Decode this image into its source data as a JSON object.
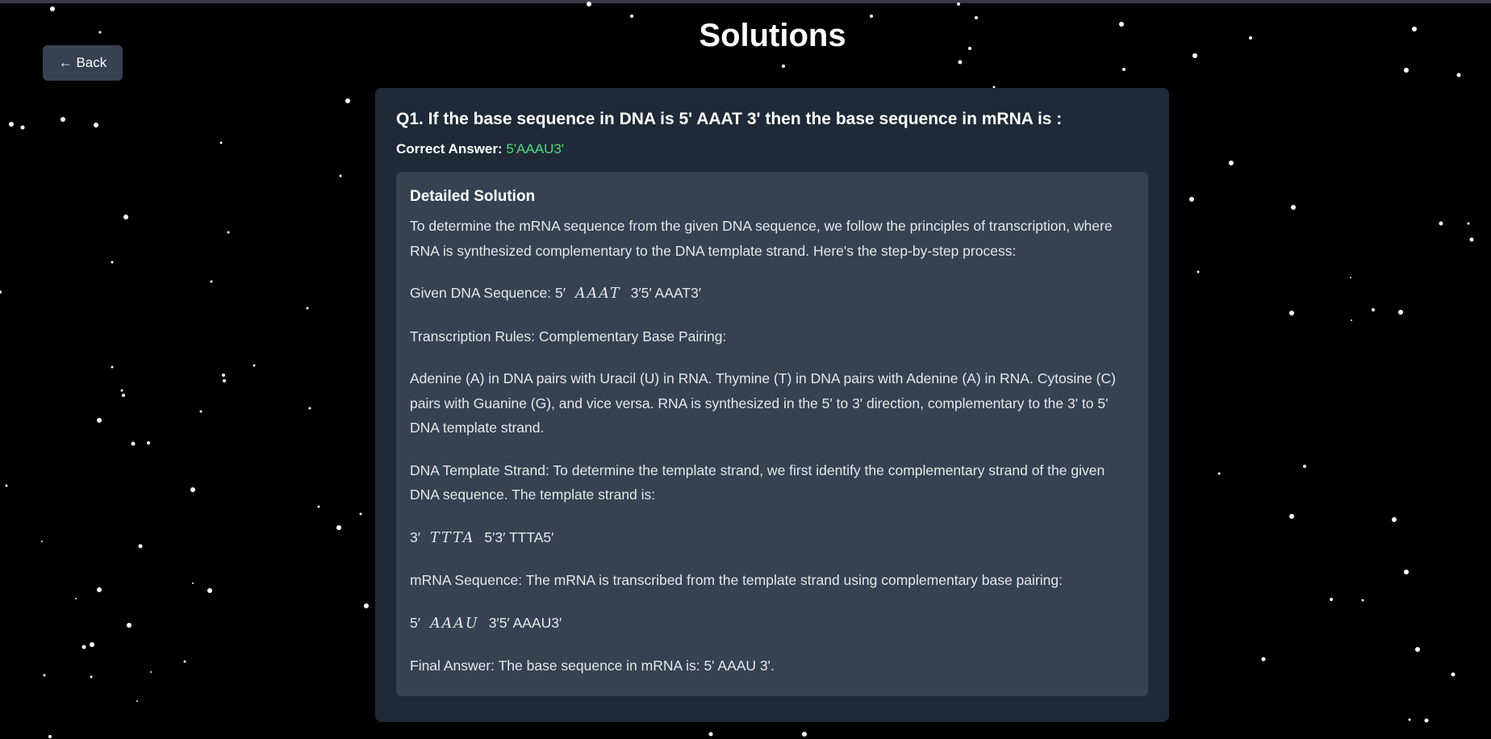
{
  "header": {
    "title": "Solutions",
    "back_label": "← Back"
  },
  "question": {
    "text": "Q1. If the base sequence in DNA is 5' AAAT 3' then the base sequence in mRNA is :",
    "correct_label": "Correct Answer: ",
    "correct_value": "5'AAAU3'"
  },
  "solution": {
    "heading": "Detailed Solution",
    "intro": "To determine the mRNA sequence from the given DNA sequence, we follow the principles of transcription, where RNA is synthesized complementary to the DNA template strand. Here's the step-by-step process:",
    "given_prefix": "Given DNA Sequence: 5′",
    "given_math": "AAAT",
    "given_suffix": "3′5′ AAAT3′",
    "rules_heading": "Transcription Rules: Complementary Base Pairing:",
    "rules_text": "Adenine (A) in DNA pairs with Uracil (U) in RNA. Thymine (T) in DNA pairs with Adenine (A) in RNA. Cytosine (C) pairs with Guanine (G), and vice versa. RNA is synthesized in the 5' to 3' direction, complementary to the 3' to 5' DNA template strand.",
    "template_text": "DNA Template Strand: To determine the template strand, we first identify the complementary strand of the given DNA sequence. The template strand is:",
    "template_prefix": "3′",
    "template_math": "TTTA",
    "template_suffix": "5′3′ TTTA5′",
    "mrna_text": "mRNA Sequence: The mRNA is transcribed from the template strand using complementary base pairing:",
    "mrna_prefix": "5′",
    "mrna_math": "AAAU",
    "mrna_suffix": "3′5′ AAAU3′",
    "final": "Final Answer: The base sequence in mRNA is: 5' AAAU 3'."
  },
  "colors": {
    "background": "#000000",
    "card": "#1f2937",
    "panel": "#374151",
    "accent_answer": "#4ade80"
  }
}
